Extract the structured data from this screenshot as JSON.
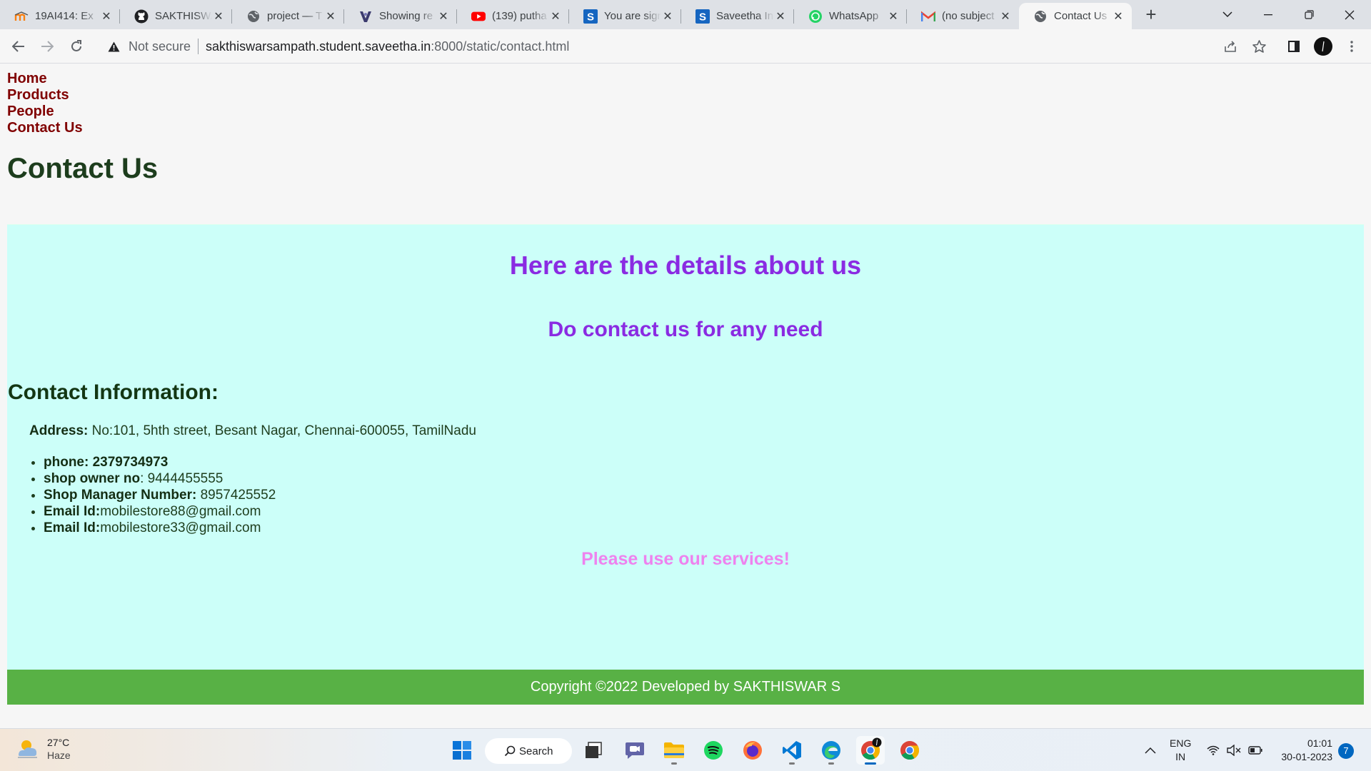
{
  "browser": {
    "tabs": [
      {
        "title": "19AI414: Ex",
        "icon": "moodle-icon"
      },
      {
        "title": "SAKTHISWA",
        "icon": "github-icon"
      },
      {
        "title": "project — T",
        "icon": "globe-icon"
      },
      {
        "title": "Showing re",
        "icon": "vercel-icon"
      },
      {
        "title": "(139) putha",
        "icon": "youtube-icon"
      },
      {
        "title": "You are sign",
        "icon": "s-icon"
      },
      {
        "title": "Saveetha In",
        "icon": "s-icon"
      },
      {
        "title": "WhatsApp",
        "icon": "whatsapp-icon"
      },
      {
        "title": "(no subject",
        "icon": "gmail-icon"
      },
      {
        "title": "Contact Us",
        "icon": "globe-icon",
        "active": true
      }
    ],
    "not_secure": "Not secure",
    "url_host": "sakthiswarsampath.student.saveetha.in",
    "url_rest": ":8000/static/contact.html"
  },
  "page": {
    "nav": [
      "Home",
      "Products",
      "People",
      "Contact Us"
    ],
    "heading": "Contact Us",
    "details_heading": "Here are the details about us",
    "contact_heading": "Do contact us for any need",
    "info_heading": "Contact Information:",
    "address_label": "Address:",
    "address_value": " No:101, 5hth street, Besant Nagar, Chennai-600055, TamilNadu",
    "list": [
      {
        "label": "phone: 2379734973",
        "value": ""
      },
      {
        "label": "shop owner no",
        "value": ": 9444455555"
      },
      {
        "label": "Shop Manager Number:",
        "value": " 8957425552"
      },
      {
        "label": "Email Id:",
        "value": "mobilestore88@gmail.com"
      },
      {
        "label": "Email Id:",
        "value": "mobilestore33@gmail.com"
      }
    ],
    "closing": "Please use our services!",
    "footer": "Copyright ©2022 Developed by SAKTHISWAR S"
  },
  "colors": {
    "panel_bg": "#ccfff9",
    "nav_link": "#800000",
    "accent_purple": "#8a2be2",
    "closing_pink": "#ee82ee",
    "footer_bg": "#58b145"
  },
  "taskbar": {
    "temperature": "27°C",
    "weather": "Haze",
    "search": "Search",
    "lang_top": "ENG",
    "lang_bottom": "IN",
    "time": "01:01",
    "date": "30-01-2023",
    "notifications": "7"
  }
}
